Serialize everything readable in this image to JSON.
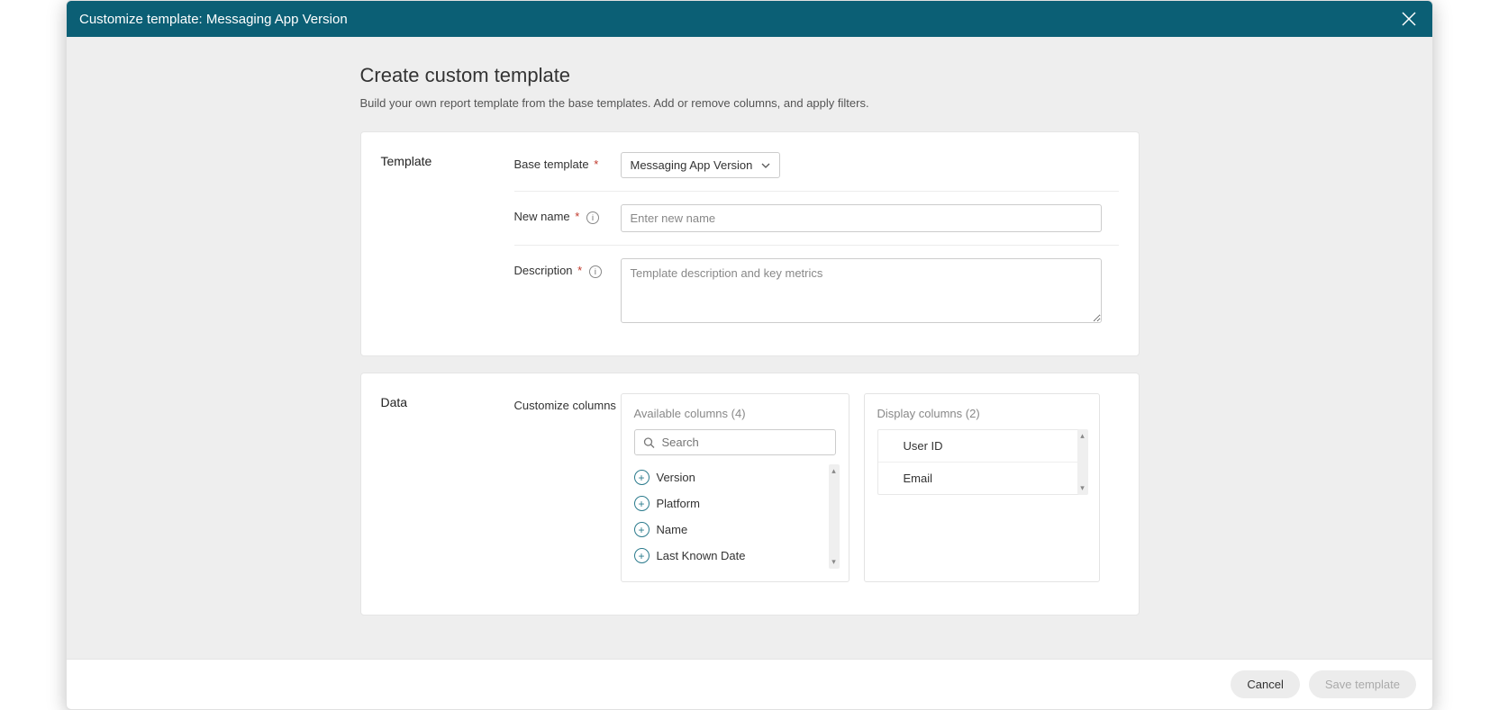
{
  "header": {
    "title": "Customize template: Messaging App Version"
  },
  "page": {
    "heading": "Create custom template",
    "subtitle": "Build your own report template from the base templates. Add or remove columns, and apply filters."
  },
  "template_section": {
    "label": "Template",
    "base_template": {
      "label": "Base template",
      "value": "Messaging App Version"
    },
    "new_name": {
      "label": "New name",
      "placeholder": "Enter new name",
      "value": ""
    },
    "description": {
      "label": "Description",
      "placeholder": "Template description and key metrics",
      "value": ""
    }
  },
  "data_section": {
    "label": "Data",
    "field_label": "Customize columns",
    "available": {
      "title": "Available columns (4)",
      "search_placeholder": "Search",
      "items": [
        "Version",
        "Platform",
        "Name",
        "Last Known Date"
      ]
    },
    "display": {
      "title": "Display columns (2)",
      "items": [
        "User ID",
        "Email"
      ]
    }
  },
  "footer": {
    "cancel": "Cancel",
    "save": "Save template"
  }
}
